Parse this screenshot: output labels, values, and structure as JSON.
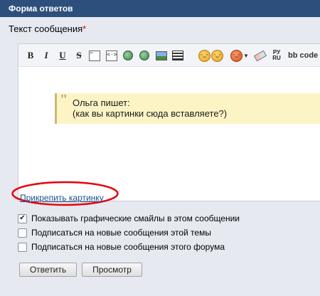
{
  "header": {
    "title": "Форма ответов"
  },
  "form": {
    "label": "Текст сообщения",
    "required_mark": "*"
  },
  "toolbar": {
    "bold": "B",
    "italic": "I",
    "underline": "U",
    "strike": "S",
    "bbcode": "bb code",
    "ruen": "РУ\nRU"
  },
  "quote": {
    "line1": "Ольга пишет:",
    "line2": "(как вы картинки сюда вставляете?)"
  },
  "attach_link": "Прикрепить картинку",
  "options": [
    {
      "label": "Показывать графические смайлы в этом сообщении",
      "checked": true
    },
    {
      "label": "Подписаться на новые сообщения этой темы",
      "checked": false
    },
    {
      "label": "Подписаться на новые сообщения этого форума",
      "checked": false
    }
  ],
  "buttons": {
    "reply": "Ответить",
    "preview": "Просмотр"
  },
  "colors": {
    "header_bg": "#2d4f7c",
    "panel_bg": "#e6e9f0",
    "quote_bg": "#fdf4c6",
    "link": "#1f4f8a",
    "annotation_ellipse": "#e8000b",
    "required": "#d40000"
  },
  "icons": [
    "code-icon",
    "link-icon",
    "email-icon",
    "image-icon",
    "video-icon",
    "smiley-icon",
    "smiley-icon",
    "smiley-dropdown-icon",
    "eraser-icon",
    "translit-icon"
  ]
}
